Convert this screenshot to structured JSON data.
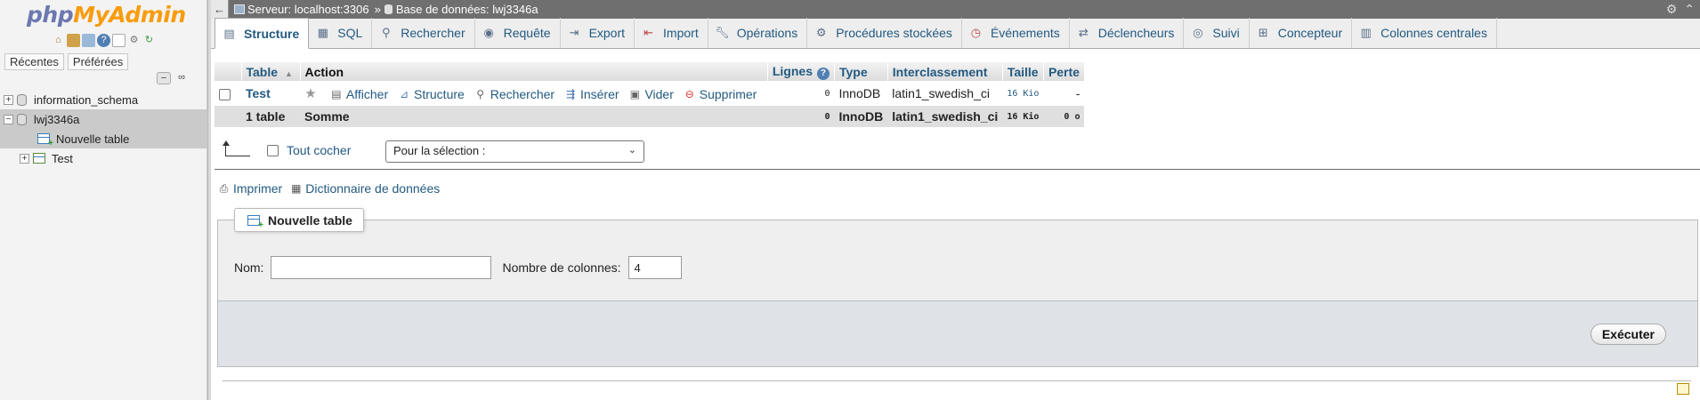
{
  "logo": {
    "php": "php",
    "my": "My",
    "admin": "Admin"
  },
  "nav": {
    "tabs": [
      "Récentes",
      "Préférées"
    ],
    "tools": {
      "collapse": "−",
      "link": "∞"
    },
    "tree": [
      {
        "label": "information_schema"
      },
      {
        "label": "lwj3346a"
      },
      {
        "label": "Nouvelle table"
      },
      {
        "label": "Test"
      }
    ]
  },
  "breadcrumb": {
    "server": "Serveur: localhost:3306",
    "separator": "»",
    "database": "Base de données: lwj3346a"
  },
  "tabs": [
    {
      "label": "Structure",
      "icon": "structure-icon"
    },
    {
      "label": "SQL",
      "icon": "sql-icon"
    },
    {
      "label": "Rechercher",
      "icon": "search-icon"
    },
    {
      "label": "Requête",
      "icon": "query-icon"
    },
    {
      "label": "Export",
      "icon": "export-icon"
    },
    {
      "label": "Import",
      "icon": "import-icon"
    },
    {
      "label": "Opérations",
      "icon": "wrench-icon"
    },
    {
      "label": "Procédures stockées",
      "icon": "routines-icon"
    },
    {
      "label": "Événements",
      "icon": "clock-icon"
    },
    {
      "label": "Déclencheurs",
      "icon": "triggers-icon"
    },
    {
      "label": "Suivi",
      "icon": "eye-icon"
    },
    {
      "label": "Concepteur",
      "icon": "designer-icon"
    },
    {
      "label": "Colonnes centrales",
      "icon": "columns-icon"
    }
  ],
  "table": {
    "headers": {
      "table": "Table",
      "action": "Action",
      "rows": "Lignes",
      "type": "Type",
      "collation": "Interclassement",
      "size": "Taille",
      "overhead": "Perte"
    },
    "rows": [
      {
        "name": "Test",
        "actions": {
          "browse": "Afficher",
          "structure": "Structure",
          "search": "Rechercher",
          "insert": "Insérer",
          "empty": "Vider",
          "drop": "Supprimer"
        },
        "rows": "0",
        "type": "InnoDB",
        "collation": "latin1_swedish_ci",
        "size": "16 Kio",
        "overhead": "-"
      }
    ],
    "summary": {
      "count": "1 table",
      "label": "Somme",
      "rows": "0",
      "type": "InnoDB",
      "collation": "latin1_swedish_ci",
      "size": "16 Kio",
      "overhead": "0 o"
    }
  },
  "bulk": {
    "check_all": "Tout cocher",
    "with_selected": "Pour la sélection :"
  },
  "links": {
    "print": "Imprimer",
    "dictionary": "Dictionnaire de données"
  },
  "create": {
    "legend": "Nouvelle table",
    "name_label": "Nom:",
    "name_value": "",
    "columns_label": "Nombre de colonnes:",
    "columns_value": "4",
    "submit": "Exécuter"
  }
}
